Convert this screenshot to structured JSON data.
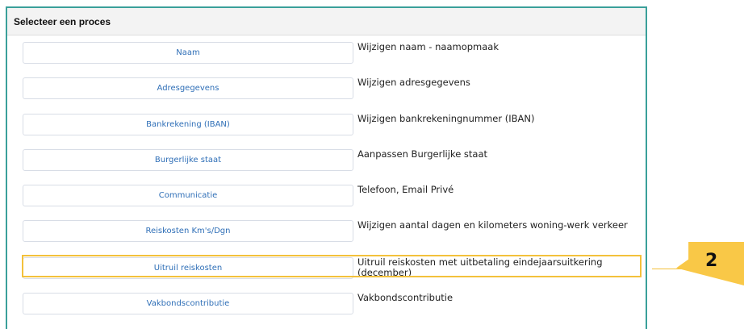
{
  "panel": {
    "title": "Selecteer een proces",
    "rows": [
      {
        "button": "Naam",
        "description": "Wijzigen naam - naamopmaak"
      },
      {
        "button": "Adresgegevens",
        "description": "Wijzigen adresgegevens"
      },
      {
        "button": "Bankrekening (IBAN)",
        "description": "Wijzigen bankrekeningnummer (IBAN)"
      },
      {
        "button": "Burgerlijke staat",
        "description": "Aanpassen Burgerlijke staat"
      },
      {
        "button": "Communicatie",
        "description": "Telefoon, Email Privé"
      },
      {
        "button": "Reiskosten Km's/Dgn",
        "description": "Wijzigen aantal dagen en kilometers woning-werk verkeer"
      },
      {
        "button": "Uitruil reiskosten",
        "description": "Uitruil reiskosten met uitbetaling eindejaarsuitkering (december)"
      },
      {
        "button": "Vakbondscontributie",
        "description": "Vakbondscontributie"
      }
    ]
  },
  "callout": {
    "number": "2",
    "color": "#f9c847"
  },
  "colors": {
    "border": "#3aa09a",
    "link": "#2f6fb7",
    "highlight": "#f3c13b"
  }
}
